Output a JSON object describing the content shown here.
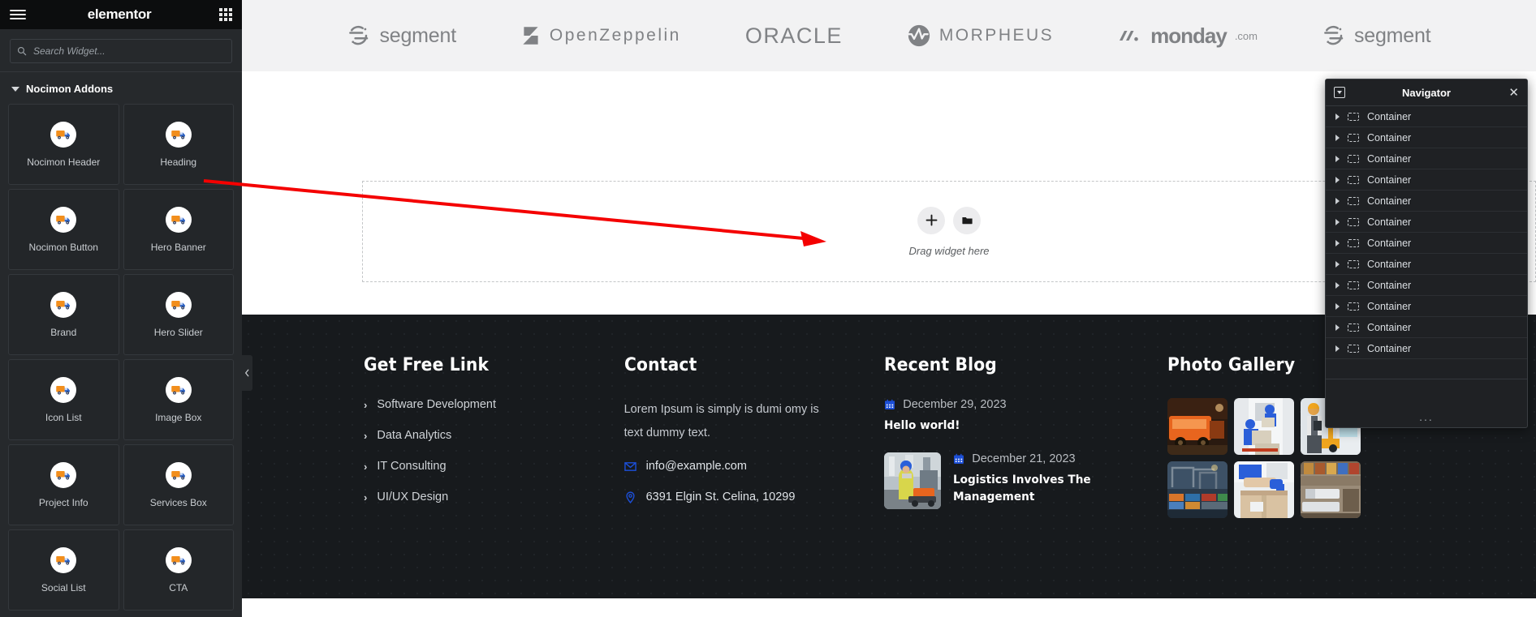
{
  "panel": {
    "brand": "elementor",
    "menu_icon": "hamburger-icon",
    "apps_icon": "apps-grid-icon",
    "search": {
      "placeholder": "Search Widget...",
      "value": "",
      "icon": "search-icon"
    },
    "category": {
      "label": "Nocimon Addons",
      "expanded": true
    },
    "widgets": [
      {
        "label": "Nocimon Header",
        "icon": "truck-icon"
      },
      {
        "label": "Heading",
        "icon": "truck-icon"
      },
      {
        "label": "Nocimon Button",
        "icon": "truck-icon"
      },
      {
        "label": "Hero Banner",
        "icon": "truck-icon"
      },
      {
        "label": "Brand",
        "icon": "truck-icon"
      },
      {
        "label": "Hero Slider",
        "icon": "truck-icon"
      },
      {
        "label": "Icon List",
        "icon": "truck-icon"
      },
      {
        "label": "Image Box",
        "icon": "truck-icon"
      },
      {
        "label": "Project Info",
        "icon": "truck-icon"
      },
      {
        "label": "Services Box",
        "icon": "truck-icon"
      },
      {
        "label": "Social List",
        "icon": "truck-icon"
      },
      {
        "label": "CTA",
        "icon": "truck-icon"
      }
    ],
    "collapse_icon": "chevron-left-icon"
  },
  "canvas": {
    "logos": [
      {
        "name": "segment",
        "text": "segment"
      },
      {
        "name": "openzeppelin",
        "text": "OpenZeppelin"
      },
      {
        "name": "oracle",
        "text": "ORACLE"
      },
      {
        "name": "morpheus",
        "text": "MORPHEUS"
      },
      {
        "name": "monday",
        "text": "monday",
        "suffix": ".com"
      },
      {
        "name": "segment2",
        "text": "segment"
      }
    ],
    "dropzone": {
      "label": "Drag widget here",
      "add_icon": "plus-icon",
      "folder_icon": "folder-icon"
    },
    "footer": {
      "col1": {
        "title": "Get Free Link",
        "links": [
          "Software Development",
          "Data Analytics",
          "IT Consulting",
          "UI/UX Design"
        ]
      },
      "col2": {
        "title": "Contact",
        "text": "Lorem Ipsum is simply is dumi omy is text dummy text.",
        "email": "info@example.com",
        "email_icon": "envelope-icon",
        "address": "6391 Elgin St. Celina, 10299",
        "address_icon": "map-pin-icon"
      },
      "col3": {
        "title": "Recent Blog",
        "date_icon": "calendar-icon",
        "posts": [
          {
            "date": "December 29, 2023",
            "title": "Hello world!",
            "has_thumb": false
          },
          {
            "date": "December 21, 2023",
            "title": "Logistics Involves The Management",
            "has_thumb": true
          }
        ]
      },
      "col4": {
        "title": "Photo Gallery",
        "images": [
          "orange-truck-at-night",
          "workers-loading-van",
          "forklift-operator",
          "port-container-cranes",
          "taping-a-box",
          "stacked-timber-and-trucks"
        ]
      }
    }
  },
  "navigator": {
    "title": "Navigator",
    "dock_icon": "dock-icon",
    "close_icon": "close-icon",
    "item_icon": "container-icon",
    "expand_icon": "chevron-right-icon",
    "items": [
      "Container",
      "Container",
      "Container",
      "Container",
      "Container",
      "Container",
      "Container",
      "Container",
      "Container",
      "Container",
      "Container",
      "Container"
    ],
    "more_label": "..."
  },
  "annotation": {
    "arrow_color": "#f40000",
    "name": "red-pointer-arrow"
  }
}
